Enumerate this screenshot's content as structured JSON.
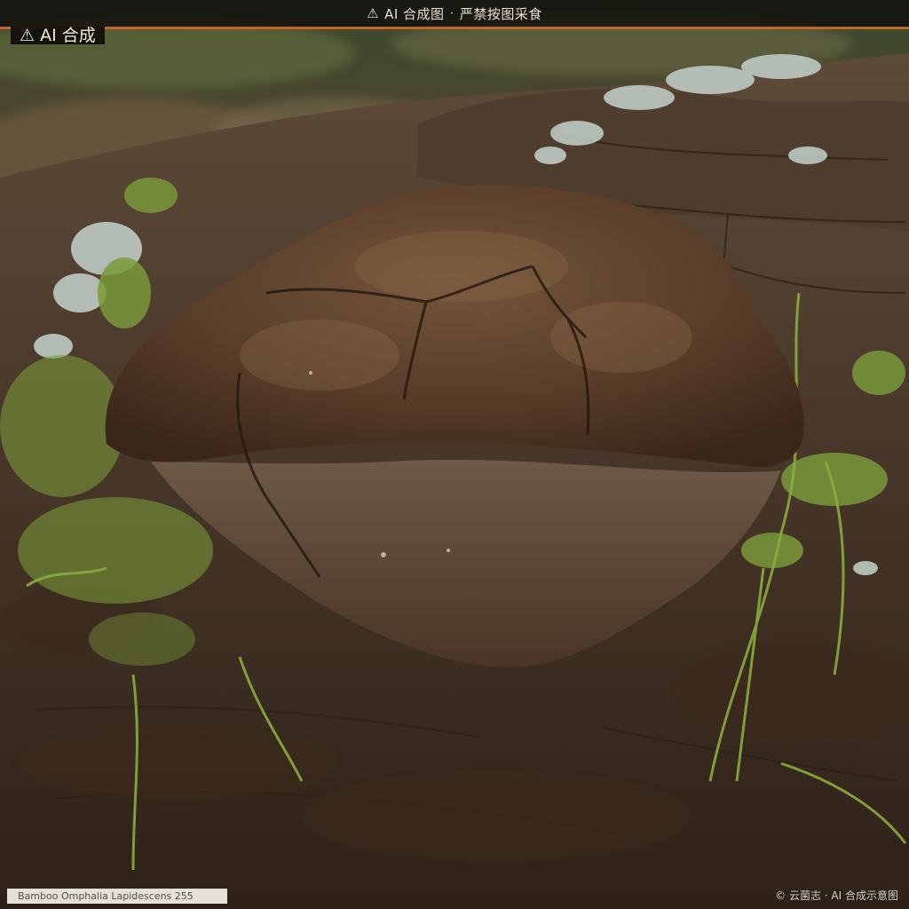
{
  "banner": {
    "icon": "warning-icon",
    "label": "AI 合成图",
    "separator": "·",
    "warning": "严禁按图采食",
    "accent_color": "#c0662a"
  },
  "corner_tag": {
    "icon": "warning-icon",
    "label": "AI 合成"
  },
  "caption": {
    "text": "Bamboo Omphalia Lapidescens 255"
  },
  "credit": {
    "text": "© 云菌志 · AI 合成示意图"
  },
  "scene": {
    "subject": "bracket-fungus-on-mossy-log",
    "colors": {
      "fungus_cap": "#5a3e2a",
      "fungus_pores": "#6e5846",
      "bark": "#3d2c1e",
      "moss": "#7a9a3a",
      "lichen": "#c4d2cc"
    }
  }
}
